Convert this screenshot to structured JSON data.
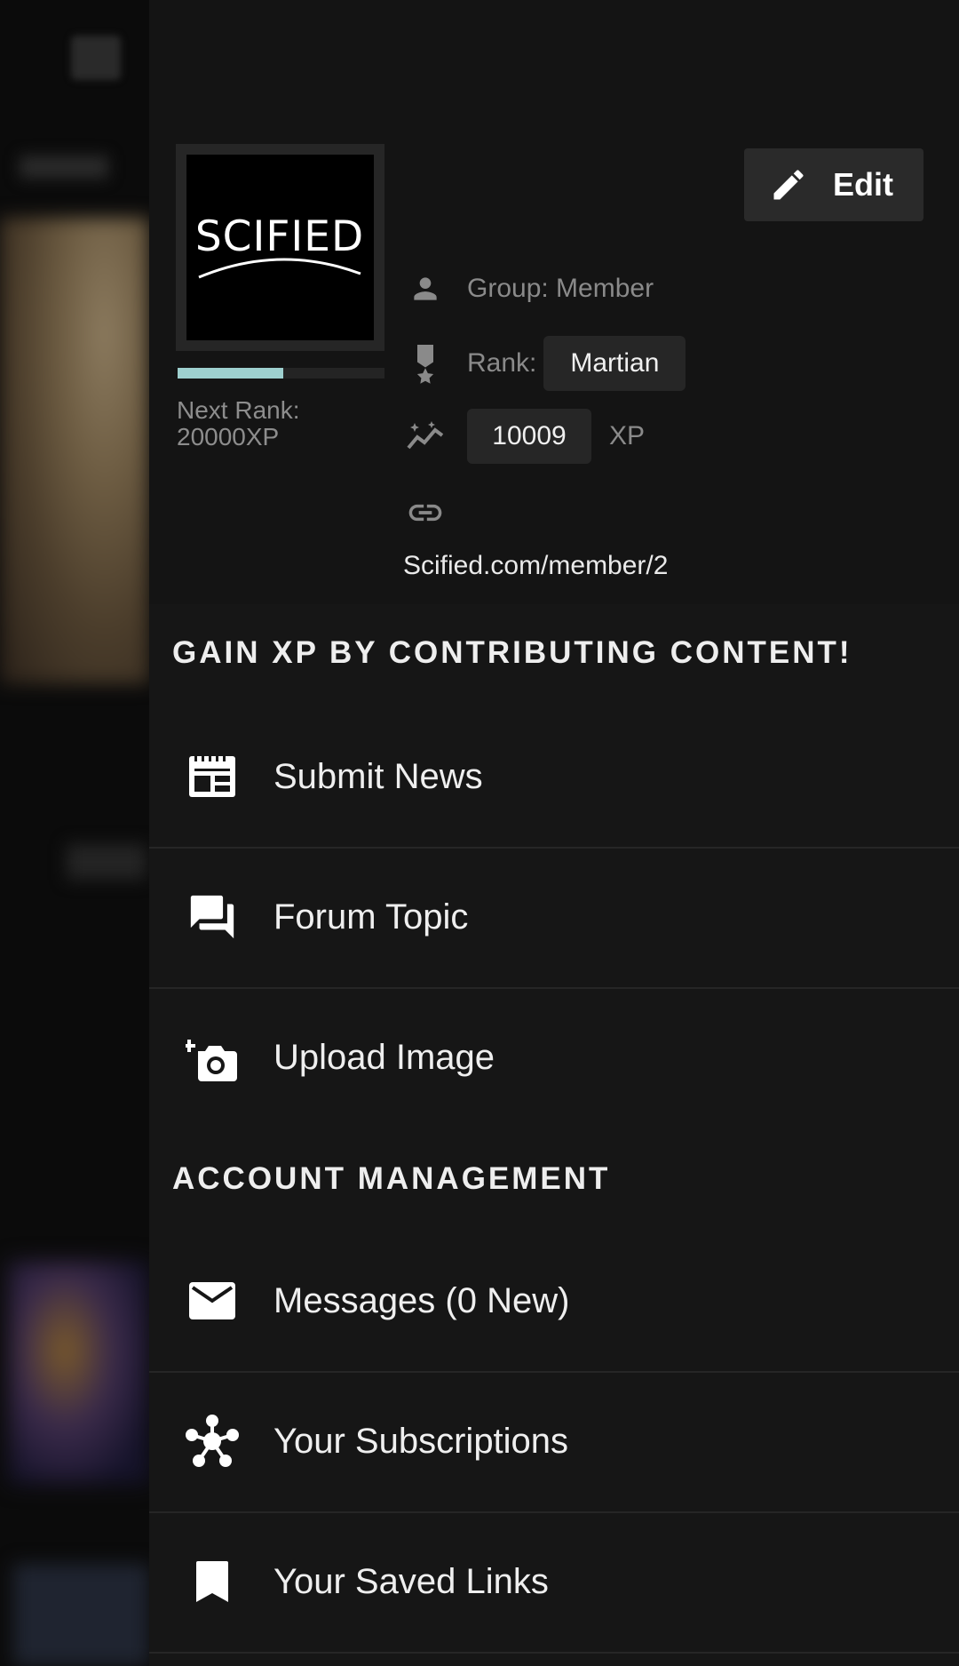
{
  "profile": {
    "avatar_text": "SCIFIED",
    "progress": 0.51,
    "next_rank": "Next Rank: 20000XP",
    "edit_label": "Edit",
    "group": "Group: Member",
    "rank_label": "Rank:",
    "rank_value": "Martian",
    "xp_value": "10009",
    "xp_unit": "XP",
    "link": "Scified.com/member/2"
  },
  "sections": {
    "contribute_heading": "GAIN XP BY CONTRIBUTING CONTENT!",
    "account_heading": "ACCOUNT MANAGEMENT"
  },
  "contribute_items": [
    {
      "label": "Submit News",
      "icon": "news-icon"
    },
    {
      "label": "Forum Topic",
      "icon": "forum-icon"
    },
    {
      "label": "Upload Image",
      "icon": "add-camera-icon"
    }
  ],
  "account_items": [
    {
      "label": "Messages (0 New)",
      "icon": "mail-icon"
    },
    {
      "label": "Your Subscriptions",
      "icon": "subscriptions-icon"
    },
    {
      "label": "Your Saved Links",
      "icon": "bookmark-icon"
    }
  ],
  "colors": {
    "drawer_bg": "#161616",
    "progress": "#9ed0cf",
    "chip_bg": "#262626"
  }
}
